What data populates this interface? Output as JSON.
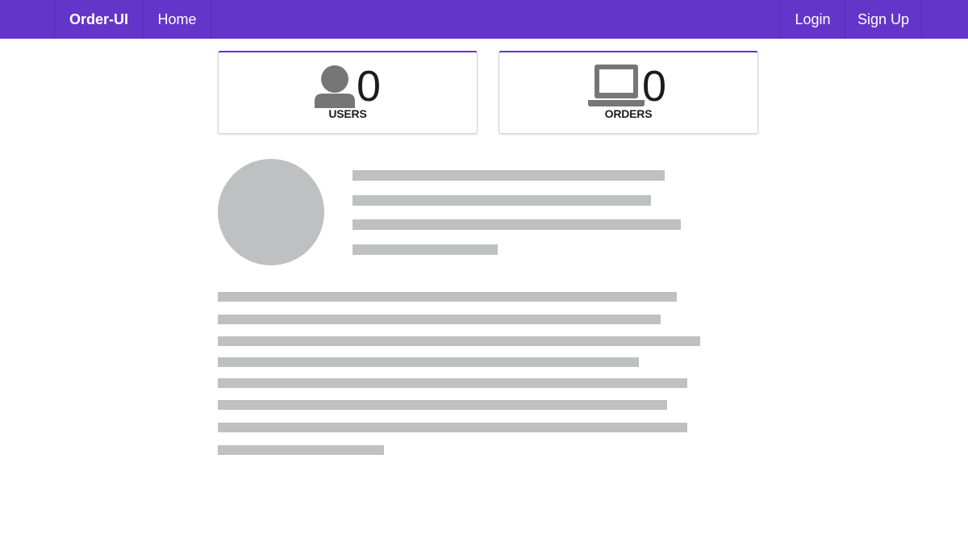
{
  "navbar": {
    "brand": "Order-UI",
    "home": "Home",
    "login": "Login",
    "signup": "Sign Up",
    "color": "#6435c9"
  },
  "stats": [
    {
      "value": "0",
      "label": "USERS",
      "icon": "user-icon"
    },
    {
      "value": "0",
      "label": "ORDERS",
      "icon": "laptop-icon"
    }
  ],
  "placeholder": {
    "color": "#bfc0c1",
    "header_line_count": 4,
    "paragraph_line_count": 8
  }
}
